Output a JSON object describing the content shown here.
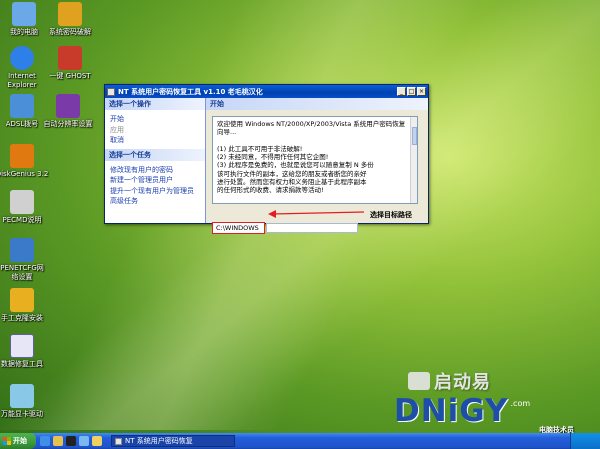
{
  "desktop": {
    "icons": [
      {
        "label": "我的电脑",
        "color": "#6aa8e8"
      },
      {
        "label": "系统密码破解",
        "color": "#e0a020"
      },
      {
        "label": "Internet Explorer",
        "color": "#2f7fe8"
      },
      {
        "label": "一键 GHOST",
        "color": "#c83a2a"
      },
      {
        "label": "ADSL拨号",
        "color": "#4a8fd8"
      },
      {
        "label": "自动分辨率设置",
        "color": "#7a3aa8"
      },
      {
        "label": "DiskGenius 3.2",
        "color": "#e07a10"
      },
      {
        "label": "PECMD说明",
        "color": "#d0d0d0"
      },
      {
        "label": "PENETCFG网络设置",
        "color": "#3a7ac8"
      },
      {
        "label": "手工克隆安装",
        "color": "#e8b020"
      },
      {
        "label": "数据修复工具",
        "color": "#e6e6f6"
      },
      {
        "label": "万能显卡驱动",
        "color": "#8ac8e8"
      }
    ]
  },
  "window": {
    "title": "NT 系统用户密码恢复工具 v1.10 老毛桃汉化",
    "controls": {
      "minimize": "_",
      "maximize": "□",
      "close": "×"
    },
    "left": {
      "section1_title": "选择一个操作",
      "section1_items": [
        {
          "label": "开始",
          "enabled": true
        },
        {
          "label": "应用",
          "enabled": false
        },
        {
          "label": "取消",
          "enabled": true
        }
      ],
      "section2_title": "选择一个任务",
      "section2_items": [
        {
          "label": "修改现有用户的密码"
        },
        {
          "label": "新建一个管理员用户"
        },
        {
          "label": "提升一个现有用户为管理员"
        },
        {
          "label": "高级任务"
        }
      ]
    },
    "right": {
      "head": "开始",
      "text": "欢迎使用 Windows NT/2000/XP/2003/Vista 系统用户密码恢复向导...\n\n(1) 此工具不可用于非法破解!\n(2) 未经同意，不得用作任何其它企图!\n(3) 此程序是免费的，也就是说您可以随意复制 N 多份\n该可执行文件的副本，这给您的朋友或者断您的亲好\n进行处置。然而您有权力和义务阻止基于此程序副本\n的任何形式的收费、请求捐款等活动!\n\n推荐您到这里下载该程序的更新版本：",
      "path_value": "C:\\WINDOWS"
    }
  },
  "annotation": {
    "label": "选择目标路径",
    "arrow_color": "#e02020"
  },
  "branding": {
    "qidongyi": "启动易",
    "dnigy": "DNiGY",
    "dot_com": ".com",
    "sub": "电脑技术员"
  },
  "taskbar": {
    "start_label": "开始",
    "task_label": "NT 系统用户密码恢复"
  }
}
